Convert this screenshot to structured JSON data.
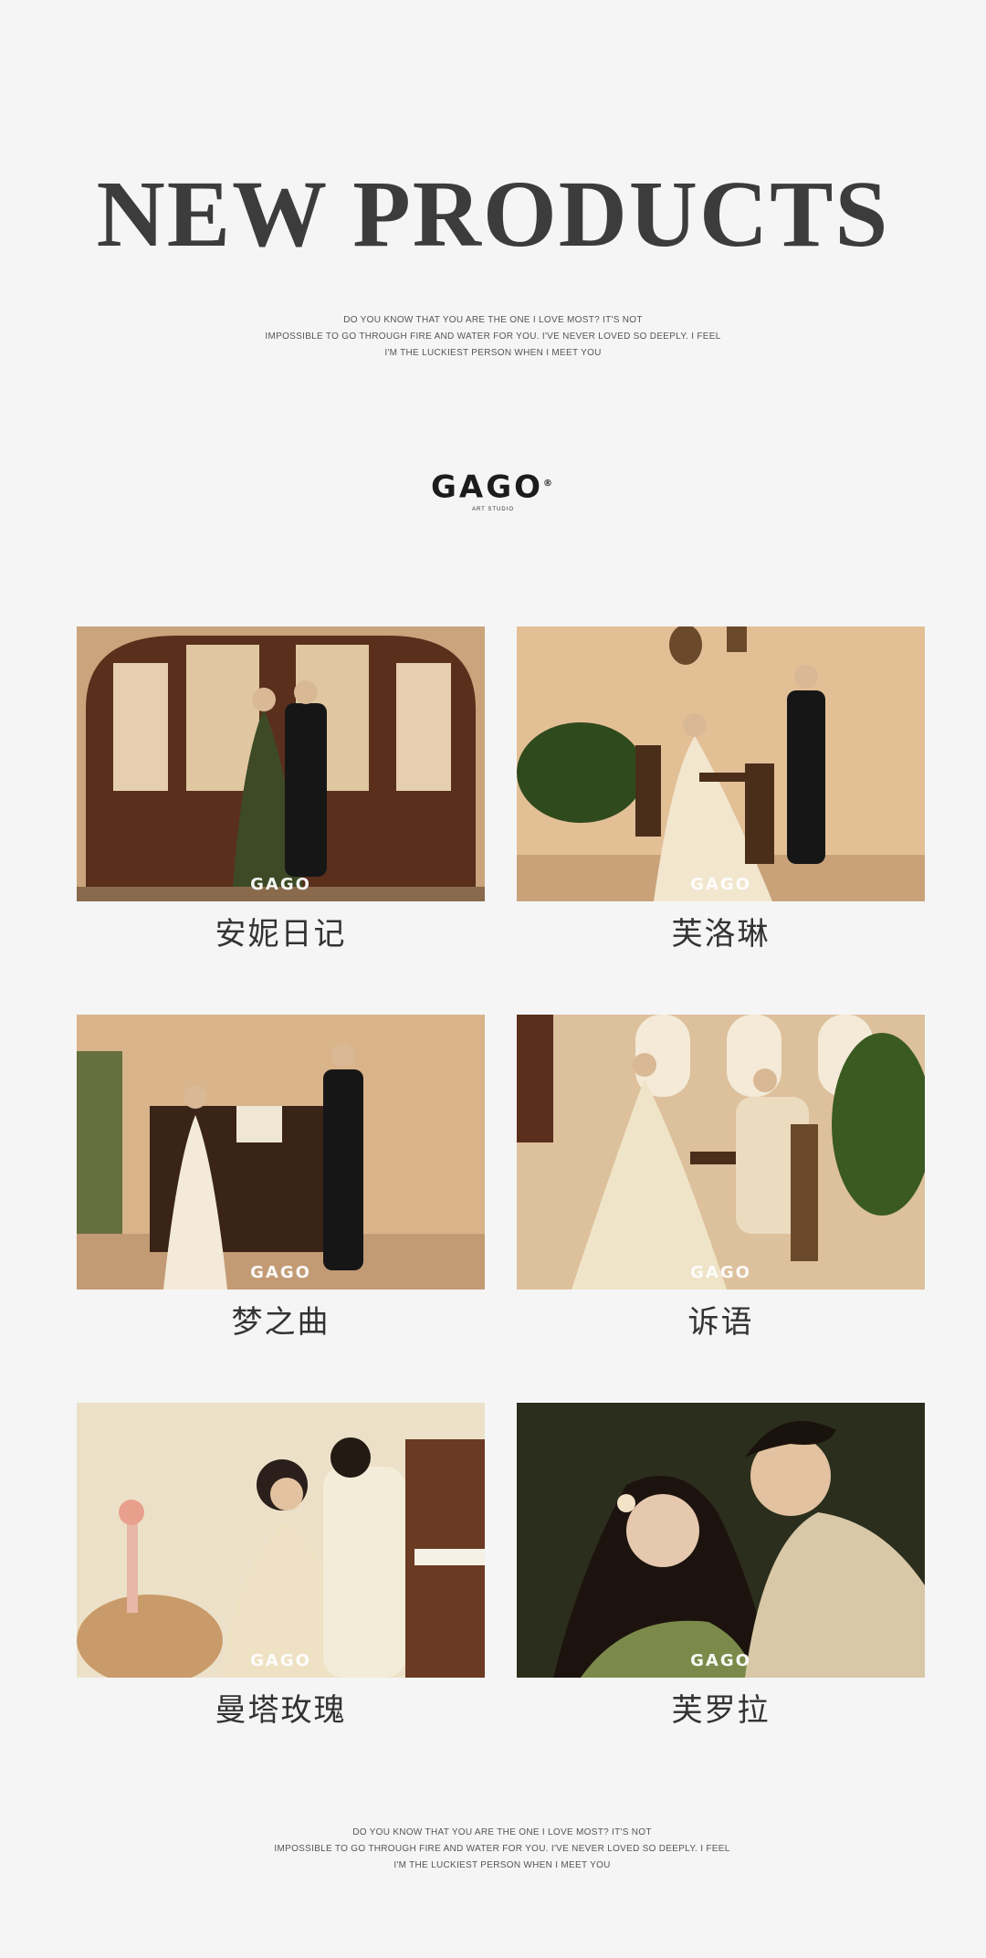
{
  "header": {
    "title": "NEW PRODUCTS",
    "tagline_lines": [
      "DO YOU KNOW THAT YOU ARE THE ONE I LOVE MOST? IT'S NOT",
      "IMPOSSIBLE TO GO THROUGH FIRE AND WATER FOR YOU. I'VE NEVER LOVED SO DEEPLY. I FEEL",
      "I'M THE LUCKIEST PERSON WHEN I MEET YOU"
    ]
  },
  "brand": {
    "logo_text": "GAGO",
    "logo_registered": "®",
    "logo_sub": "ART STUDIO",
    "watermark": "GAGO"
  },
  "products": [
    {
      "name": "安妮日记",
      "palette": [
        "#b89370",
        "#5a2f1c",
        "#3e4a26"
      ]
    },
    {
      "name": "芙洛琳",
      "palette": [
        "#e6c39c",
        "#c9a27a",
        "#2f4a1c"
      ]
    },
    {
      "name": "梦之曲",
      "palette": [
        "#dbb48c",
        "#b48e6a",
        "#3a2418"
      ]
    },
    {
      "name": "诉语",
      "palette": [
        "#e2c8a6",
        "#f1e4cb",
        "#3a5a22"
      ]
    },
    {
      "name": "曼塔玫瑰",
      "palette": [
        "#e8dcc2",
        "#c99b6a",
        "#f3ecd8"
      ]
    },
    {
      "name": "芙罗拉",
      "palette": [
        "#2b2e1c",
        "#d8c8a8",
        "#7b8a4a"
      ]
    }
  ],
  "footer": {
    "tagline_lines": [
      "DO YOU KNOW THAT YOU ARE THE ONE I LOVE MOST? IT'S NOT",
      "IMPOSSIBLE TO GO THROUGH FIRE AND WATER FOR YOU. I'VE NEVER LOVED SO DEEPLY. I FEEL",
      "I'M THE LUCKIEST PERSON WHEN I MEET YOU"
    ]
  }
}
